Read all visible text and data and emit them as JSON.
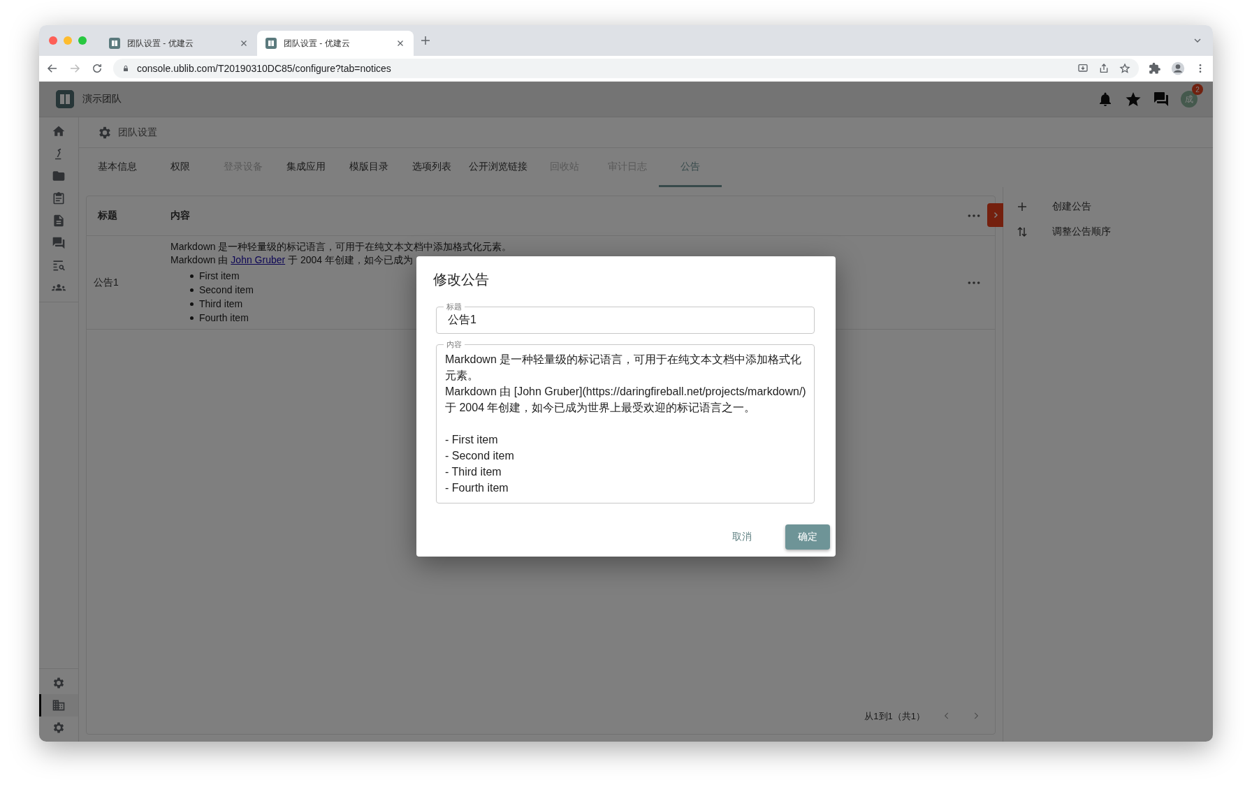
{
  "browser": {
    "tabs": [
      {
        "title": "团队设置 - 优建云",
        "selected": false
      },
      {
        "title": "团队设置 - 优建云",
        "selected": true
      }
    ],
    "url": "console.ublib.com/T20190310DC85/configure?tab=notices"
  },
  "app_header": {
    "team_name": "演示团队",
    "notification_count": "2",
    "avatar": "成"
  },
  "sidebar": {
    "items": [
      {
        "selected": false
      },
      {
        "selected": false
      },
      {
        "selected": false
      },
      {
        "selected": false
      },
      {
        "selected": false
      },
      {
        "selected": false
      },
      {
        "selected": false
      },
      {
        "selected": false
      }
    ],
    "bottom_items": [
      {
        "selected": false
      },
      {
        "selected": true
      },
      {
        "selected": false
      }
    ]
  },
  "page_title": "团队设置",
  "tabs": [
    {
      "label": "基本信息",
      "selected": false,
      "disabled": false
    },
    {
      "label": "权限",
      "selected": false,
      "disabled": false
    },
    {
      "label": "登录设备",
      "selected": false,
      "disabled": true
    },
    {
      "label": "集成应用",
      "selected": false,
      "disabled": false
    },
    {
      "label": "模版目录",
      "selected": false,
      "disabled": false
    },
    {
      "label": "选项列表",
      "selected": false,
      "disabled": false
    },
    {
      "label": "公开浏览链接",
      "selected": false,
      "disabled": false
    },
    {
      "label": "回收站",
      "selected": false,
      "disabled": true
    },
    {
      "label": "审计日志",
      "selected": false,
      "disabled": true
    },
    {
      "label": "公告",
      "selected": true,
      "disabled": false
    }
  ],
  "table": {
    "columns": [
      "标题",
      "内容"
    ],
    "rows": [
      {
        "title": "公告1",
        "paragraph": "Markdown 是一种轻量级的标记语言，可用于在纯文本文档中添加格式化元素。",
        "line_before_link": "Markdown 由",
        "link": "John Gruber",
        "line_after_link": "于 2004 年创建，如今已成为",
        "list": [
          "First item",
          "Second item",
          "Third item",
          "Fourth item"
        ]
      }
    ]
  },
  "pagination": {
    "summary": "从1到1（共1）"
  },
  "side_panel": {
    "actions": [
      {
        "label": "创建公告"
      },
      {
        "label": "调整公告顺序"
      }
    ]
  },
  "dialog": {
    "title": "修改公告",
    "fields": [
      {
        "kind": "input",
        "label": "标题",
        "value": "公告1"
      },
      {
        "kind": "textarea",
        "label": "内容",
        "value": "Markdown 是一种轻量级的标记语言，可用于在纯文本文档中添加格式化元素。\nMarkdown 由 [John Gruber](https://daringfireball.net/projects/markdown/) 于 2004 年创建，如今已成为世界上最受欢迎的标记语言之一。\n\n- First item\n- Second item\n- Third item\n- Fourth item"
      }
    ],
    "buttons": [
      {
        "label": "取消",
        "kind": "text"
      },
      {
        "label": "确定",
        "kind": "primary"
      }
    ]
  }
}
